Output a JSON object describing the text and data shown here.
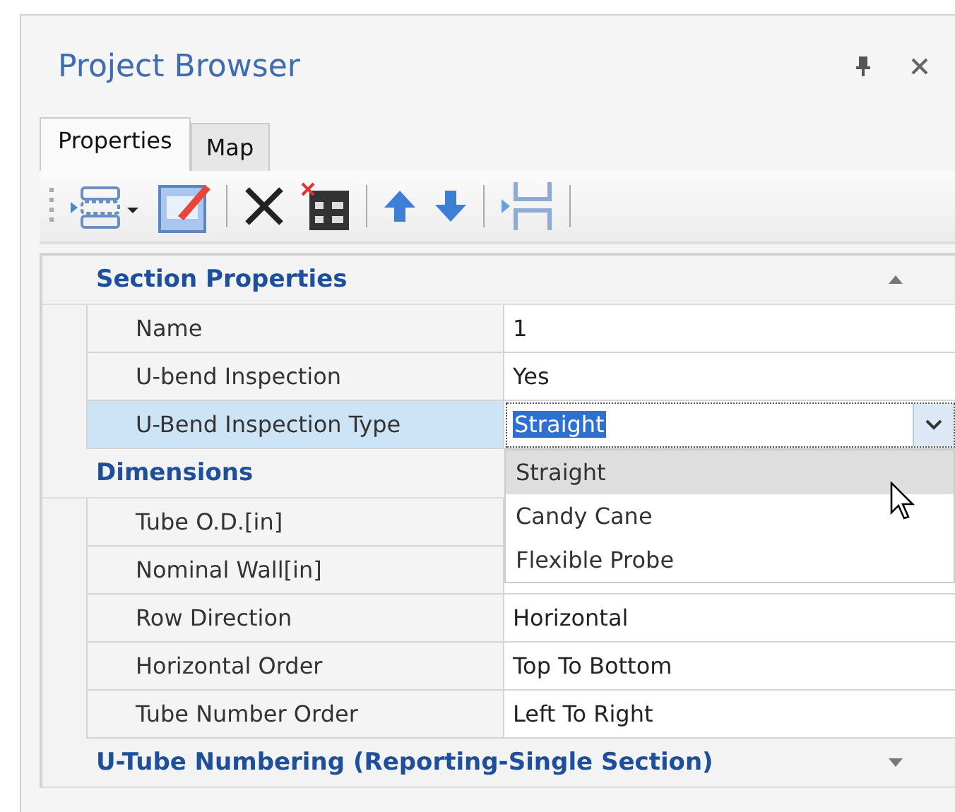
{
  "panel": {
    "title": "Project Browser"
  },
  "tabs": [
    {
      "label": "Properties",
      "selected": true
    },
    {
      "label": "Map",
      "selected": false
    }
  ],
  "categories": [
    {
      "title": "Section Properties",
      "expanded": true,
      "rows": [
        {
          "label": "Name",
          "value": "1",
          "selected": false
        },
        {
          "label": "U-bend Inspection",
          "value": "Yes",
          "selected": false
        },
        {
          "label": "U-Bend Inspection Type",
          "value": "Straight",
          "selected": true,
          "kind": "dropdown",
          "options": [
            {
              "label": "Straight",
              "selected": true
            },
            {
              "label": "Candy Cane",
              "selected": false
            },
            {
              "label": "Flexible Probe",
              "selected": false
            }
          ]
        }
      ]
    },
    {
      "title": "Dimensions",
      "rows": [
        {
          "label": "Tube O.D.[in]",
          "selected": false
        },
        {
          "label": "Nominal Wall[in]",
          "selected": false
        },
        {
          "label": "Row Direction",
          "value": "Horizontal",
          "selected": false
        },
        {
          "label": "Horizontal Order",
          "value": "Top To Bottom",
          "selected": false
        },
        {
          "label": "Tube Number Order",
          "value": "Left To Right",
          "selected": false
        }
      ]
    },
    {
      "title": "U-Tube Numbering (Reporting-Single Section)",
      "expanded": false
    }
  ]
}
